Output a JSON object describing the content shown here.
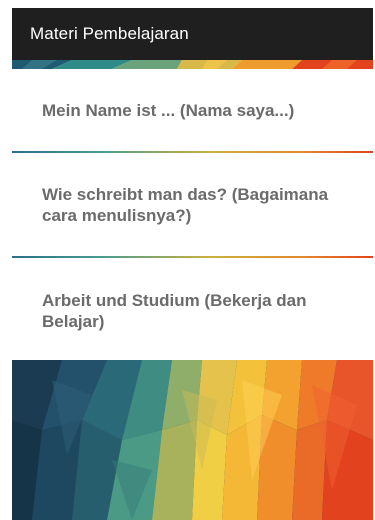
{
  "app_bar": {
    "title": "Materi Pembelajaran"
  },
  "menu": {
    "items": [
      {
        "label": "Mein Name ist ... (Nama saya...)"
      },
      {
        "label": "Wie schreibt man das? (Bagaimana cara menulisnya?)"
      },
      {
        "label": "Arbeit und Studium (Bekerja dan Belajar)"
      }
    ]
  },
  "theme": {
    "app_bar_color": "#1f1f1f",
    "item_text_color": "#6b6b6b",
    "background": "#ffffff",
    "accent_palette": [
      "#1f3f5a",
      "#2f8b87",
      "#e3c04a",
      "#f0a32a",
      "#e2431e"
    ]
  }
}
